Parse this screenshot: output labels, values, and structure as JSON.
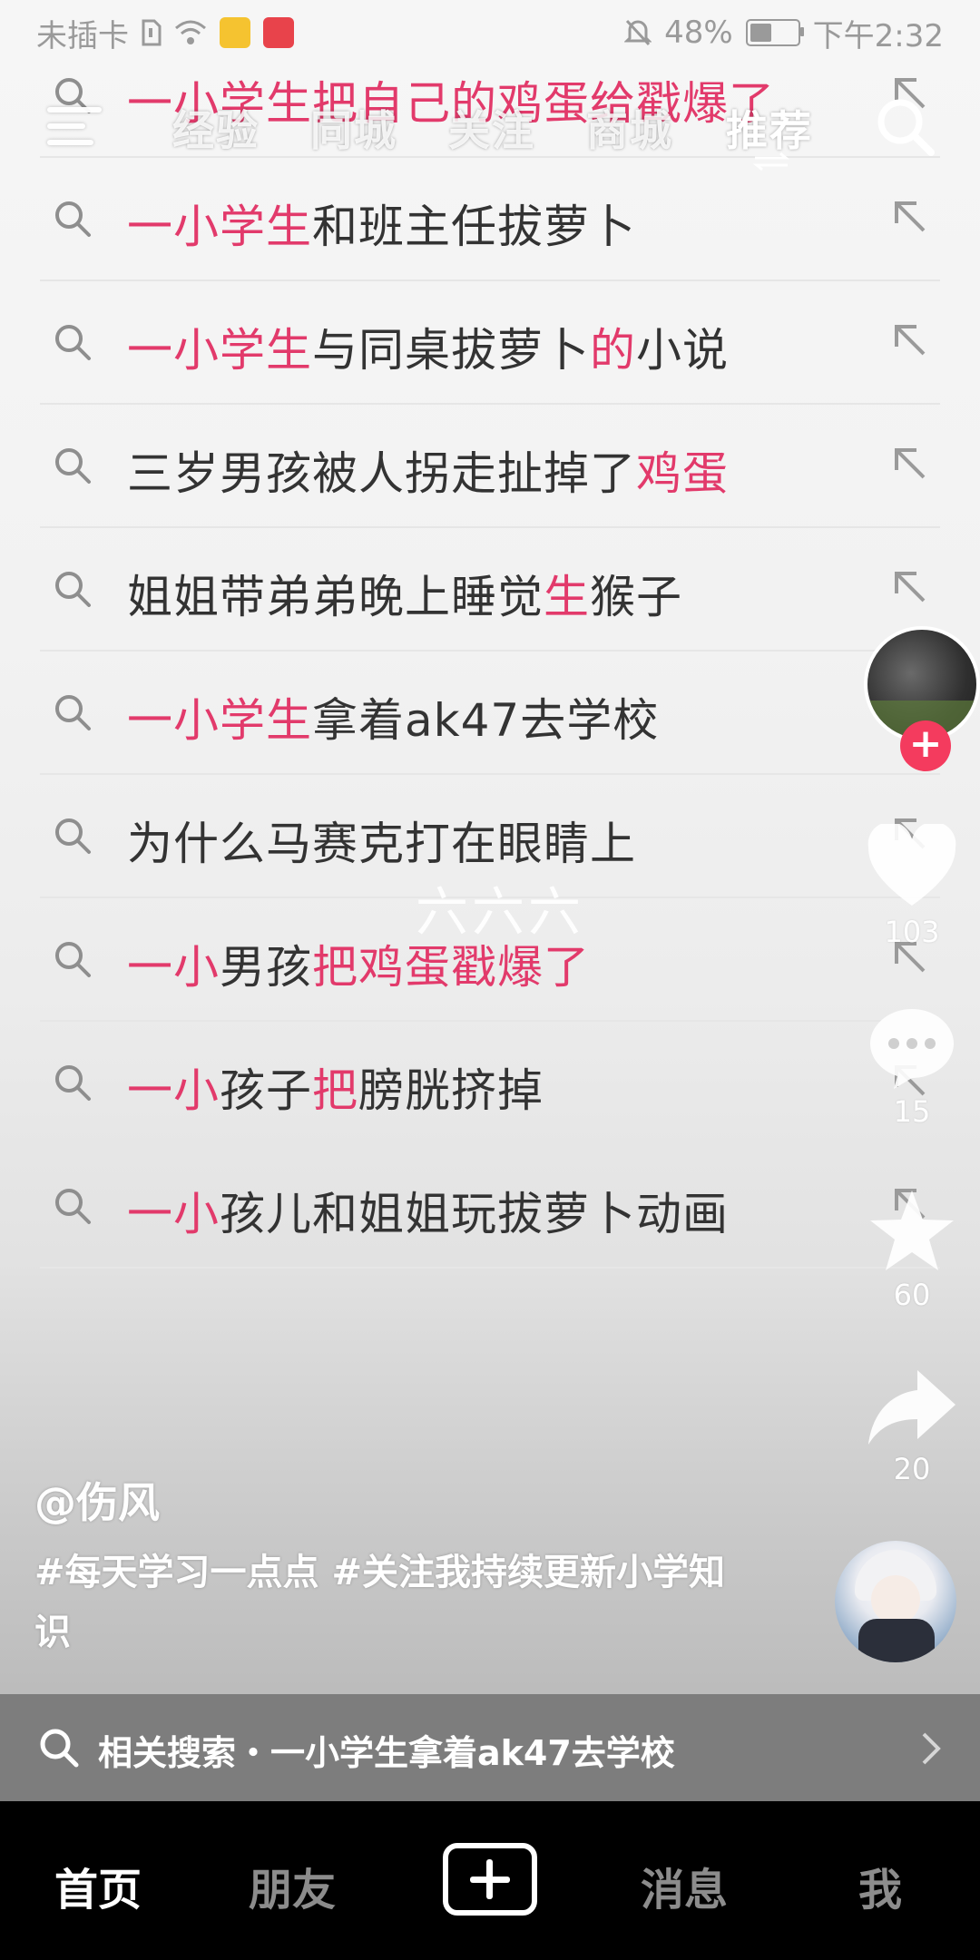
{
  "status_bar": {
    "carrier": "未插卡",
    "battery_percent": "48%",
    "battery_level": 0.48,
    "time": "下午2:32"
  },
  "top_nav": {
    "tabs": [
      "经验",
      "同城",
      "关注",
      "商城",
      "推荐"
    ],
    "active_tab": "推荐"
  },
  "suggestions": [
    {
      "parts": [
        {
          "t": "一小学生把自己的鸡蛋给戳爆了",
          "hl": true
        }
      ]
    },
    {
      "parts": [
        {
          "t": "一小学生",
          "hl": true
        },
        {
          "t": "和班主任拔萝卜",
          "hl": false
        }
      ]
    },
    {
      "parts": [
        {
          "t": "一小学生",
          "hl": true
        },
        {
          "t": "与同桌拔萝卜",
          "hl": false
        },
        {
          "t": "的",
          "hl": true
        },
        {
          "t": "小说",
          "hl": false
        }
      ]
    },
    {
      "parts": [
        {
          "t": "三岁男孩被人拐走扯掉了",
          "hl": false
        },
        {
          "t": "鸡蛋",
          "hl": true
        }
      ]
    },
    {
      "parts": [
        {
          "t": "姐姐带弟弟晚上睡觉",
          "hl": false
        },
        {
          "t": "生",
          "hl": true
        },
        {
          "t": "猴子",
          "hl": false
        }
      ]
    },
    {
      "parts": [
        {
          "t": "一小学生",
          "hl": true
        },
        {
          "t": "拿着ak47去学校",
          "hl": false
        }
      ]
    },
    {
      "parts": [
        {
          "t": "为什么马赛克打在眼睛上",
          "hl": false
        }
      ]
    },
    {
      "parts": [
        {
          "t": "一小",
          "hl": true
        },
        {
          "t": "男孩",
          "hl": false
        },
        {
          "t": "把鸡蛋戳爆了",
          "hl": true
        }
      ]
    },
    {
      "parts": [
        {
          "t": "一小",
          "hl": true
        },
        {
          "t": "孩子",
          "hl": false
        },
        {
          "t": "把",
          "hl": true
        },
        {
          "t": "膀胱挤掉",
          "hl": false
        }
      ]
    },
    {
      "parts": [
        {
          "t": "一小",
          "hl": true
        },
        {
          "t": "孩儿和姐姐玩拔萝卜动画",
          "hl": false
        }
      ]
    }
  ],
  "watermark": "六六六",
  "actions": {
    "likes": "103",
    "comments": "15",
    "favorites": "60",
    "shares": "20"
  },
  "caption": {
    "username": "@伤风",
    "description": "#每天学习一点点 #关注我持续更新小学知识"
  },
  "related_search": "相关搜索・一小学生拿着ak47去学校",
  "bottom_nav": {
    "home": "首页",
    "friends": "朋友",
    "messages": "消息",
    "me": "我"
  },
  "colors": {
    "highlight": "#e23a6b",
    "follow": "#f43b5e",
    "nav_bg": "#000000"
  }
}
